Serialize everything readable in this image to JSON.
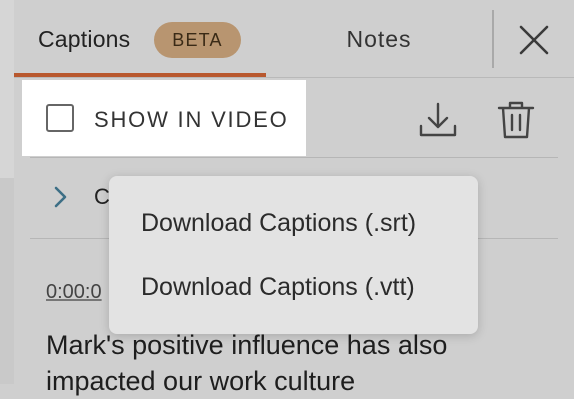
{
  "tabs": {
    "captions_label": "Captions",
    "beta_label": "BETA",
    "notes_label": "Notes",
    "close_icon": "close-icon"
  },
  "toolbar": {
    "show_in_video_label": "SHOW IN VIDEO",
    "show_in_video_checked": false,
    "download_icon": "download-icon",
    "delete_icon": "trash-icon"
  },
  "section": {
    "chevron_icon": "chevron-right-icon",
    "title_visible": "C"
  },
  "caption": {
    "timestamp_visible": "0:00:0",
    "text": "Mark's positive influence has also impacted our work culture"
  },
  "download_menu": {
    "items": [
      "Download Captions (.srt)",
      "Download Captions (.vtt)"
    ]
  },
  "colors": {
    "accent_underline": "#b8582e",
    "beta_badge_bg": "#b89570",
    "chevron": "#3d6f86",
    "panel_bg": "#cfcfcf",
    "menu_bg": "#e3e3e3"
  }
}
